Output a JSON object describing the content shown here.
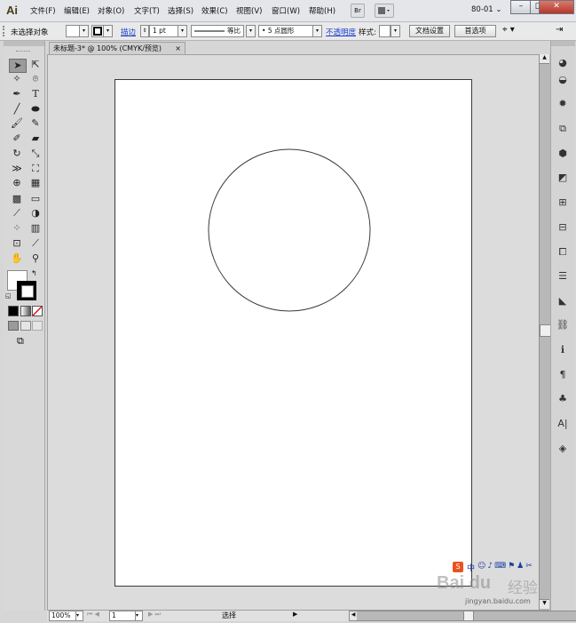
{
  "app": {
    "logo": "Ai",
    "menu": [
      "文件(F)",
      "编辑(E)",
      "对象(O)",
      "文字(T)",
      "选择(S)",
      "效果(C)",
      "视图(V)",
      "窗口(W)",
      "帮助(H)"
    ],
    "bridge_label": "Br",
    "workspace": "80-01"
  },
  "control_bar": {
    "selection_status": "未选择对象",
    "stroke_link": "描边",
    "stroke_weight": "1 pt",
    "stroke_profile": "等比",
    "brush": "5 点圆形",
    "opacity_link": "不透明度",
    "style_label": "样式:",
    "doc_setup_button": "文档设置",
    "preferences_button": "首选项"
  },
  "document": {
    "tab_title": "未标题-3* @ 100% (CMYK/预览)",
    "tab_close": "×"
  },
  "status_bar": {
    "zoom": "100%",
    "page": "1",
    "tool_status": "选择"
  },
  "watermark": {
    "logo_text": "Bai du",
    "cn_text": "经验",
    "url": "jingyan.baidu.com",
    "toolbar_text": "中"
  },
  "colors": {
    "menubar_bg": "#e4e6ea",
    "canvas_bg": "#dcdcdc",
    "artboard_bg": "#ffffff",
    "link_blue": "#1a3fd0",
    "close_red": "#b4382a",
    "circle_stroke": "#3a3a3a"
  },
  "icons": {
    "tools": [
      "selection-icon",
      "direct-selection-icon",
      "magic-wand-icon",
      "lasso-icon",
      "pen-icon",
      "type-icon",
      "line-icon",
      "ellipse-icon",
      "paintbrush-icon",
      "pencil-icon",
      "blob-brush-icon",
      "eraser-icon",
      "rotate-icon",
      "scale-icon",
      "width-icon",
      "free-transform-icon",
      "shape-builder-icon",
      "perspective-grid-icon",
      "mesh-icon",
      "gradient-icon",
      "eyedropper-icon",
      "blend-icon",
      "symbol-sprayer-icon",
      "column-graph-icon",
      "artboard-icon",
      "slice-icon",
      "hand-icon",
      "zoom-icon"
    ],
    "dock": [
      "color-icon",
      "color-guide-icon",
      "brushes-icon",
      "symbols-icon",
      "graphic-styles-icon",
      "appearance-icon",
      "transparency-icon",
      "align-icon",
      "pathfinder-icon",
      "transform-icon",
      "stroke-icon",
      "gradient-panel-icon",
      "layers-links-icon",
      "info-icon",
      "paragraph-icon",
      "symbol-club-icon",
      "character-icon",
      "layers-icon"
    ]
  }
}
